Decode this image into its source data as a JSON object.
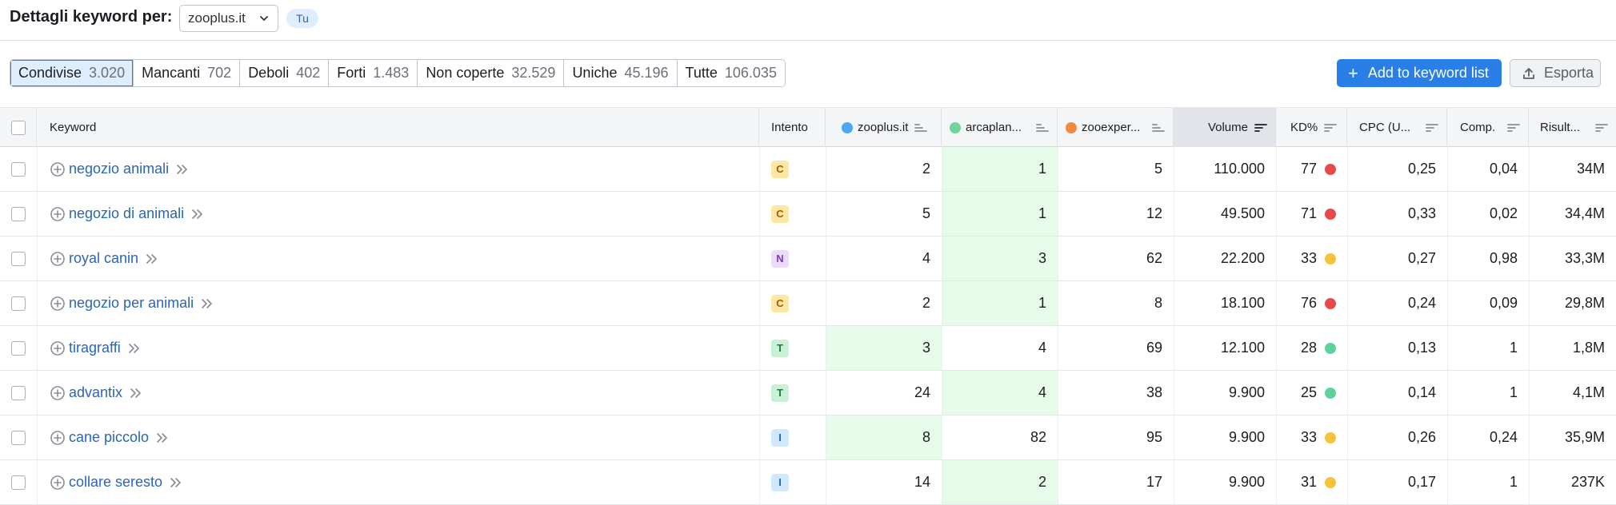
{
  "header": {
    "title": "Dettagli keyword per:",
    "domain": "zooplus.it",
    "you_badge": "Tu"
  },
  "filters": [
    {
      "label": "Condivise",
      "count": "3.020",
      "active": true
    },
    {
      "label": "Mancanti",
      "count": "702"
    },
    {
      "label": "Deboli",
      "count": "402"
    },
    {
      "label": "Forti",
      "count": "1.483"
    },
    {
      "label": "Non coperte",
      "count": "32.529"
    },
    {
      "label": "Uniche",
      "count": "45.196"
    },
    {
      "label": "Tutte",
      "count": "106.035"
    }
  ],
  "actions": {
    "add_label": "Add to keyword list",
    "export_label": "Esporta"
  },
  "columns": {
    "keyword": "Keyword",
    "intent": "Intento",
    "d1": "zooplus.it",
    "d2": "arcaplan...",
    "d3": "zooexper...",
    "volume": "Volume",
    "kd": "KD%",
    "cpc": "CPC (U...",
    "comp": "Comp.",
    "results": "Risult..."
  },
  "domain_colors": {
    "d1": "#4aa9f5",
    "d2": "#6fd39a",
    "d3": "#f08a3e"
  },
  "intent_colors": {
    "C": {
      "bg": "#fde7a3",
      "fg": "#a05c00"
    },
    "N": {
      "bg": "#ecdcfb",
      "fg": "#7a3bd1"
    },
    "T": {
      "bg": "#c8f1d5",
      "fg": "#1f7a43"
    },
    "I": {
      "bg": "#cfe8fd",
      "fg": "#2464b5"
    }
  },
  "kd_colors": {
    "red": "#e74a4a",
    "yellow": "#f5c33b",
    "green": "#5ed29b"
  },
  "rows": [
    {
      "keyword": "negozio animali",
      "intent": "C",
      "d1": "2",
      "d2": "1",
      "d3": "5",
      "volume": "110.000",
      "kd": "77",
      "kd_level": "red",
      "cpc": "0,25",
      "comp": "0,04",
      "results": "34M",
      "best": "d2"
    },
    {
      "keyword": "negozio di animali",
      "intent": "C",
      "d1": "5",
      "d2": "1",
      "d3": "12",
      "volume": "49.500",
      "kd": "71",
      "kd_level": "red",
      "cpc": "0,33",
      "comp": "0,02",
      "results": "34,4M",
      "best": "d2"
    },
    {
      "keyword": "royal canin",
      "intent": "N",
      "d1": "4",
      "d2": "3",
      "d3": "62",
      "volume": "22.200",
      "kd": "33",
      "kd_level": "yellow",
      "cpc": "0,27",
      "comp": "0,98",
      "results": "33,3M",
      "best": "d2"
    },
    {
      "keyword": "negozio per animali",
      "intent": "C",
      "d1": "2",
      "d2": "1",
      "d3": "8",
      "volume": "18.100",
      "kd": "76",
      "kd_level": "red",
      "cpc": "0,24",
      "comp": "0,09",
      "results": "29,8M",
      "best": "d2"
    },
    {
      "keyword": "tiragraffi",
      "intent": "T",
      "d1": "3",
      "d2": "4",
      "d3": "69",
      "volume": "12.100",
      "kd": "28",
      "kd_level": "green",
      "cpc": "0,13",
      "comp": "1",
      "results": "1,8M",
      "best": "d1"
    },
    {
      "keyword": "advantix",
      "intent": "T",
      "d1": "24",
      "d2": "4",
      "d3": "38",
      "volume": "9.900",
      "kd": "25",
      "kd_level": "green",
      "cpc": "0,14",
      "comp": "1",
      "results": "4,1M",
      "best": "d2"
    },
    {
      "keyword": "cane piccolo",
      "intent": "I",
      "d1": "8",
      "d2": "82",
      "d3": "95",
      "volume": "9.900",
      "kd": "33",
      "kd_level": "yellow",
      "cpc": "0,26",
      "comp": "0,24",
      "results": "35,9M",
      "best": "d1"
    },
    {
      "keyword": "collare seresto",
      "intent": "I",
      "d1": "14",
      "d2": "2",
      "d3": "17",
      "volume": "9.900",
      "kd": "31",
      "kd_level": "yellow",
      "cpc": "0,17",
      "comp": "1",
      "results": "237K",
      "best": "d2"
    }
  ]
}
